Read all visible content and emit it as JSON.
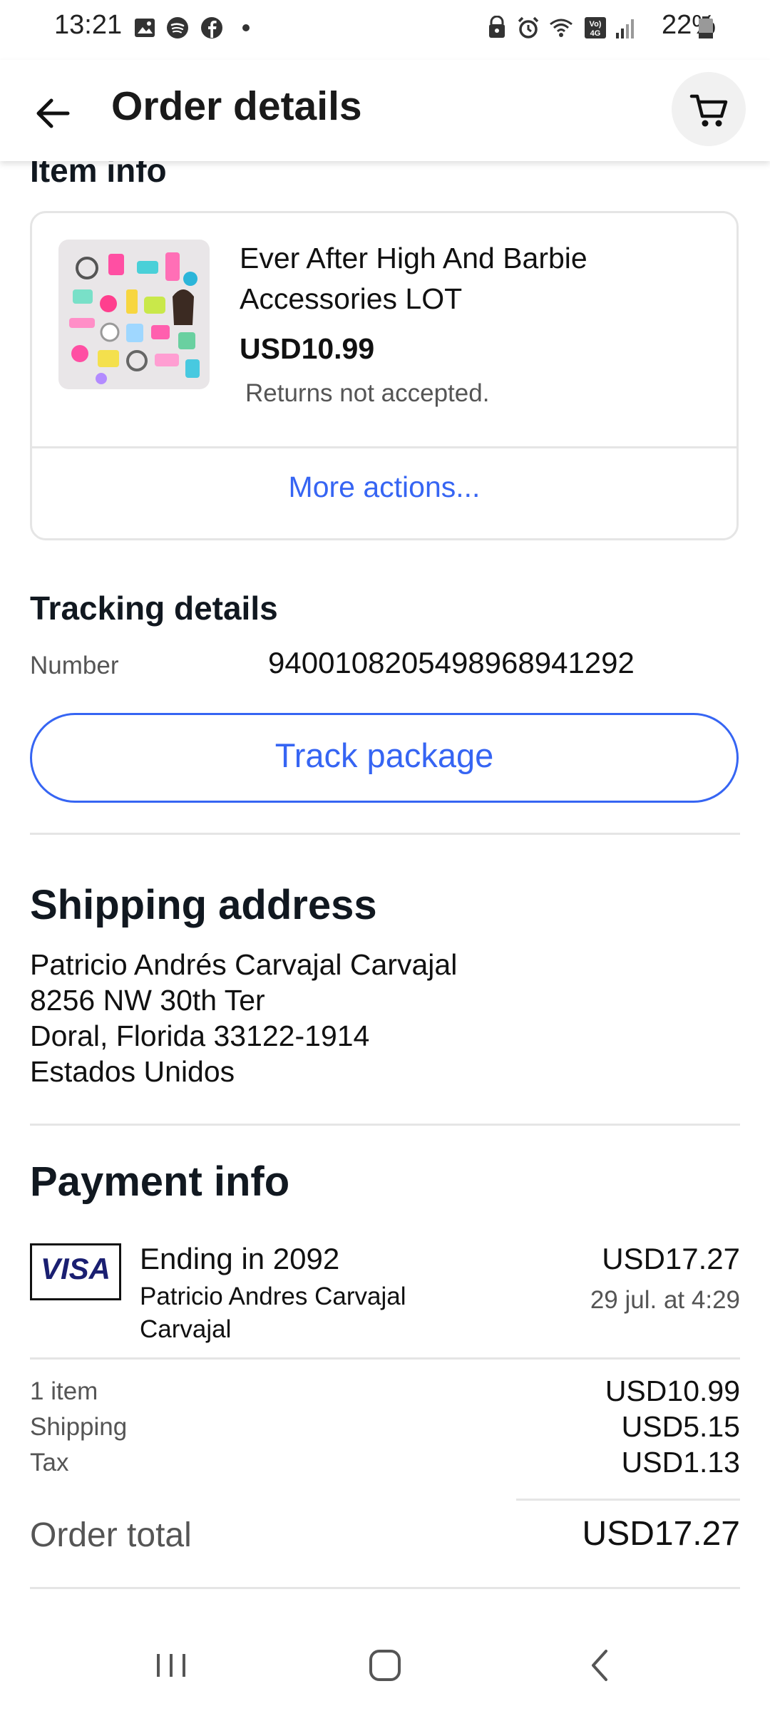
{
  "status_bar": {
    "time": "13:21",
    "battery": "22%",
    "left_icons": [
      "gallery-icon",
      "spotify-icon",
      "facebook-icon",
      "dot-icon"
    ],
    "right_icons": [
      "security-icon",
      "alarm-icon",
      "wifi-icon",
      "volte-icon",
      "signal-icon",
      "battery-icon"
    ]
  },
  "header": {
    "title": "Order details",
    "back_icon": "arrow-left-icon",
    "cart_icon": "cart-icon"
  },
  "item_info": {
    "heading": "Item info",
    "title": "Ever After High And Barbie Accessories LOT",
    "price": "USD10.99",
    "returns": "Returns not accepted.",
    "more_actions": "More actions..."
  },
  "tracking": {
    "heading": "Tracking details",
    "number_label": "Number",
    "number_value": "9400108205498968941292",
    "track_button": "Track package"
  },
  "shipping": {
    "heading": "Shipping address",
    "lines": [
      "Patricio Andrés  Carvajal Carvajal",
      "8256 NW 30th Ter",
      "Doral, Florida 33122-1914",
      "Estados Unidos"
    ]
  },
  "payment": {
    "heading": "Payment info",
    "card_brand": "VISA",
    "card_ending": "Ending in 2092",
    "cardholder": "Patricio Andres Carvajal Carvajal",
    "amount": "USD17.27",
    "date": "29 jul. at 4:29",
    "summary": [
      {
        "label": "1 item",
        "value": "USD10.99"
      },
      {
        "label": "Shipping",
        "value": "USD5.15"
      },
      {
        "label": "Tax",
        "value": "USD1.13"
      }
    ],
    "total_label": "Order total",
    "total_value": "USD17.27"
  },
  "colors": {
    "accent": "#3665f3",
    "text": "#111820",
    "muted": "#555555",
    "divider": "#e5e5e5"
  },
  "nav_bar": {
    "icons": [
      "recent-apps-icon",
      "home-icon",
      "back-icon"
    ]
  }
}
